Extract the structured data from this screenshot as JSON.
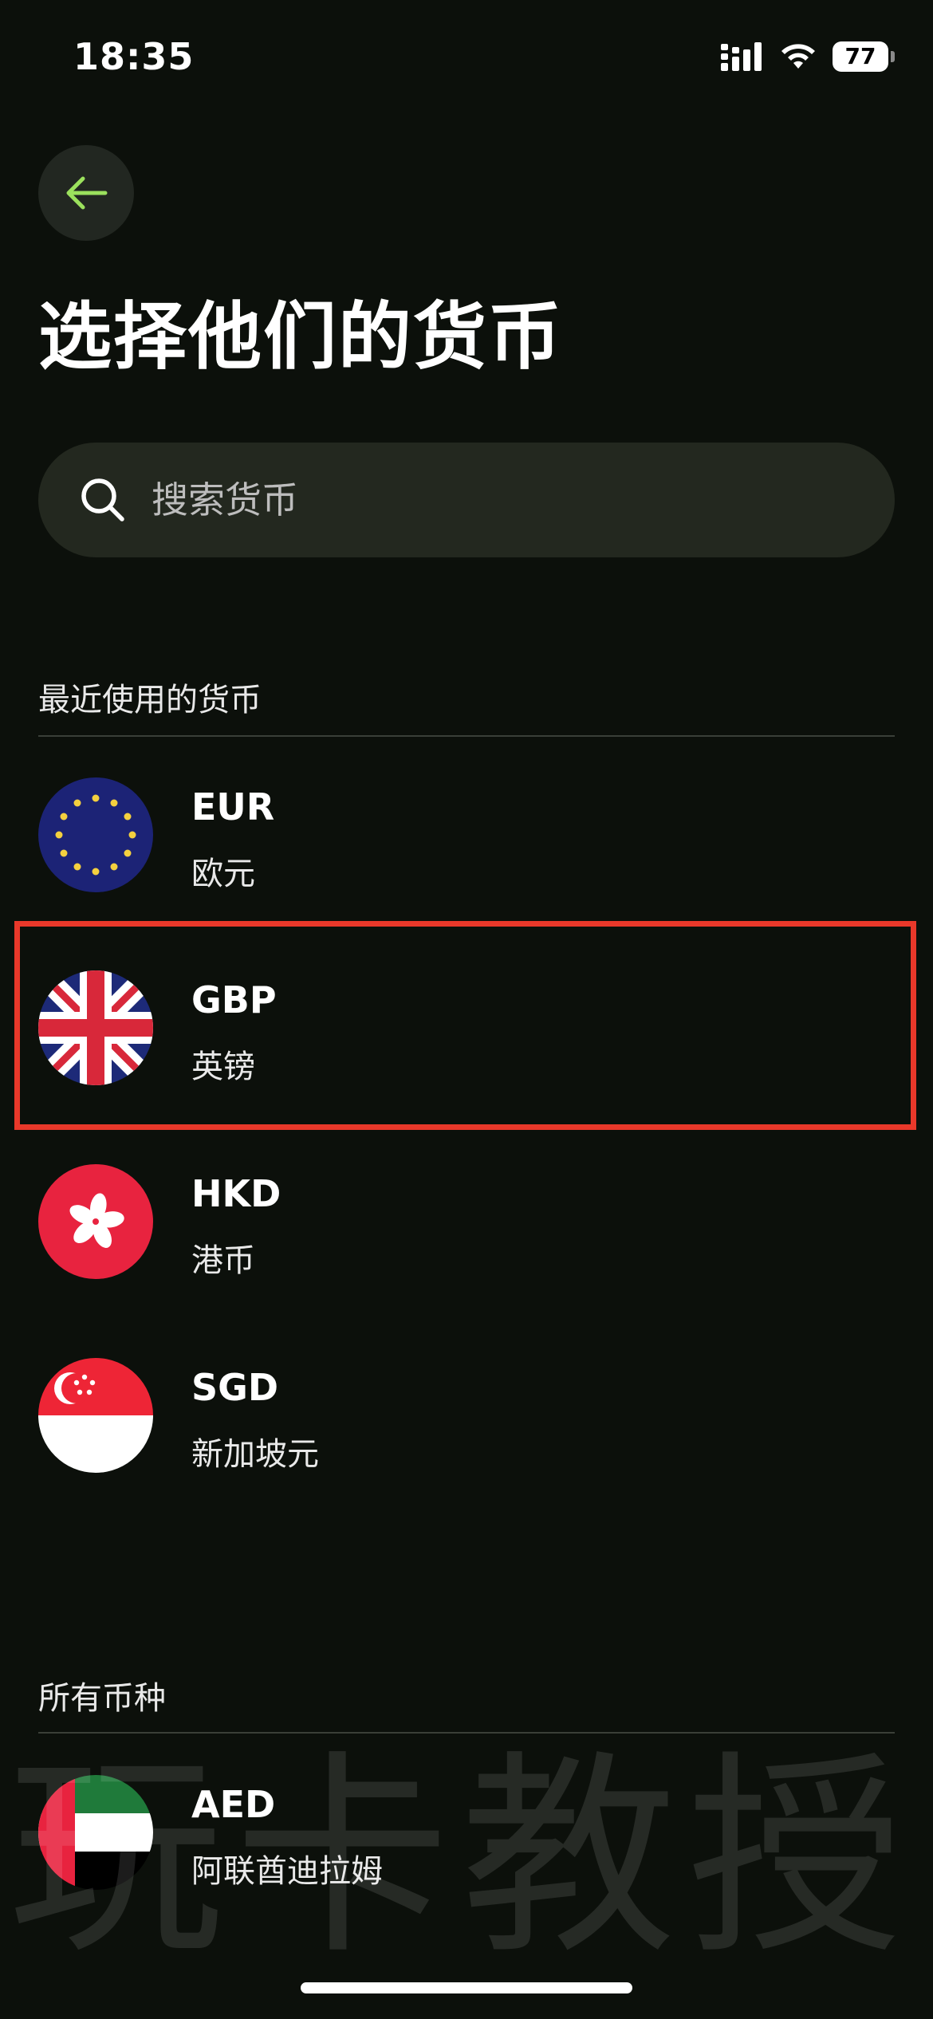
{
  "status_bar": {
    "time": "18:35",
    "battery": "77"
  },
  "header": {
    "title": "选择他们的货币"
  },
  "search": {
    "placeholder": "搜索货币",
    "value": ""
  },
  "recent": {
    "title": "最近使用的货币",
    "items": [
      {
        "code": "EUR",
        "name": "欧元",
        "flag": "eu-flag-icon"
      },
      {
        "code": "GBP",
        "name": "英镑",
        "flag": "uk-flag-icon"
      },
      {
        "code": "HKD",
        "name": "港币",
        "flag": "hk-flag-icon"
      },
      {
        "code": "SGD",
        "name": "新加坡元",
        "flag": "sg-flag-icon"
      }
    ]
  },
  "all": {
    "title": "所有币种",
    "items": [
      {
        "code": "AED",
        "name": "阿联酋迪拉姆",
        "flag": "uae-flag-icon"
      }
    ]
  },
  "watermark": "玩卡教授",
  "colors": {
    "background": "#0c100b",
    "accent": "#9be15d",
    "highlight": "#e9382a"
  }
}
